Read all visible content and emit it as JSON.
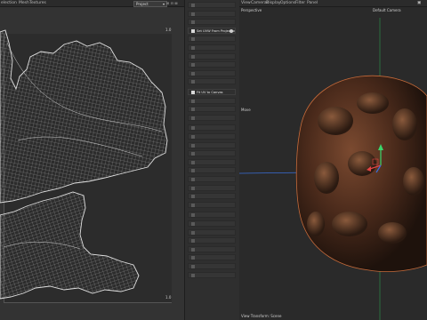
{
  "uv_editor": {
    "menu": [
      "election",
      "Mesh",
      "Textures"
    ],
    "dropdown_value": "Project",
    "corner_top_right": "1.0",
    "corner_bottom_right": "1.0"
  },
  "tools": [
    {
      "label": "",
      "active": false
    },
    {
      "label": "",
      "active": false
    },
    {
      "label": "",
      "active": false
    },
    {
      "label": "Set UVW From Projection",
      "active": true,
      "gear": true
    },
    {
      "label": "",
      "active": false
    },
    {
      "label": "",
      "active": false
    },
    {
      "label": "",
      "active": false
    },
    {
      "label": "",
      "active": false
    },
    {
      "label": "",
      "active": false
    },
    {
      "label": "",
      "active": false
    },
    {
      "label": "Fit UV to Canvas",
      "active": true
    },
    {
      "label": "",
      "active": false
    },
    {
      "label": "",
      "active": false
    },
    {
      "label": "",
      "active": false
    },
    {
      "label": "",
      "active": false
    },
    {
      "label": "",
      "active": false
    },
    {
      "label": "",
      "active": false
    },
    {
      "label": "",
      "active": false
    },
    {
      "label": "",
      "active": false
    },
    {
      "label": "",
      "active": false
    },
    {
      "label": "",
      "active": false
    },
    {
      "label": "",
      "active": false
    },
    {
      "label": "",
      "active": false
    },
    {
      "label": "",
      "active": false
    },
    {
      "label": "",
      "active": false
    },
    {
      "label": "",
      "active": false
    },
    {
      "label": "",
      "active": false
    },
    {
      "label": "",
      "active": false
    },
    {
      "label": "",
      "active": false
    },
    {
      "label": "",
      "active": false
    },
    {
      "label": "",
      "active": false
    },
    {
      "label": "",
      "active": false
    }
  ],
  "viewport": {
    "menu": [
      "View",
      "Cameras",
      "Display",
      "Options",
      "Filter",
      "Panel"
    ],
    "mode_label": "Perspective",
    "camera_label": "Default Camera",
    "move_label": "Move",
    "footer": "View Transform: Scene"
  },
  "colors": {
    "uv_wire": "#d9d9d9",
    "axis_y": "#3bd66b",
    "axis_x": "#e24444",
    "axis_z": "#3a6fd9",
    "rock": "#6b3f2a"
  }
}
